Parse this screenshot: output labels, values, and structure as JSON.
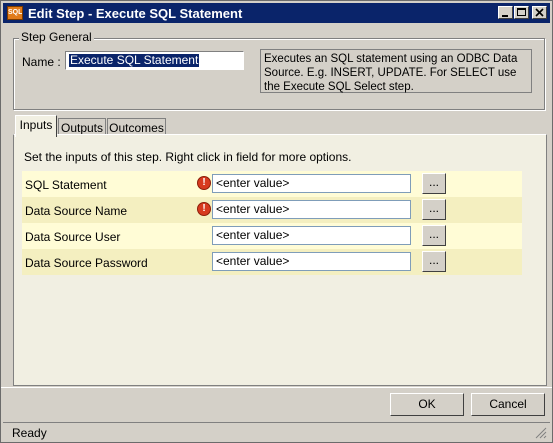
{
  "window": {
    "title": "Edit Step - Execute SQL Statement",
    "app_icon_text": "SQL",
    "controls": [
      "minimize",
      "maximize",
      "close"
    ]
  },
  "step_general": {
    "legend": "Step General",
    "name_label": "Name :",
    "name_value": "Execute SQL Statement",
    "description": "Executes an SQL statement using an ODBC Data Source. E.g. INSERT, UPDATE. For SELECT use the Execute SQL Select step."
  },
  "tabs": [
    {
      "label": "Inputs",
      "active": true
    },
    {
      "label": "Outputs",
      "active": false
    },
    {
      "label": "Outcomes",
      "active": false
    }
  ],
  "inputs": {
    "instructions": "Set the inputs of this step.  Right click in field for more options.",
    "rows": [
      {
        "label": "SQL Statement",
        "value": "<enter value>",
        "required": true,
        "button": "..."
      },
      {
        "label": "Data Source Name",
        "value": "<enter value>",
        "required": true,
        "button": "..."
      },
      {
        "label": "Data Source User",
        "value": "<enter value>",
        "required": false,
        "button": "..."
      },
      {
        "label": "Data Source Password",
        "value": "<enter value>",
        "required": false,
        "button": "..."
      }
    ]
  },
  "footer": {
    "ok_label": "OK",
    "cancel_label": "Cancel"
  },
  "status": {
    "text": "Ready"
  },
  "colors": {
    "titlebar": "#0a246a",
    "row_light": "#fffcd6",
    "row_dark": "#f4efc0",
    "warning": "#d73a1f"
  },
  "icons": {
    "warning": "exclamation-icon"
  }
}
